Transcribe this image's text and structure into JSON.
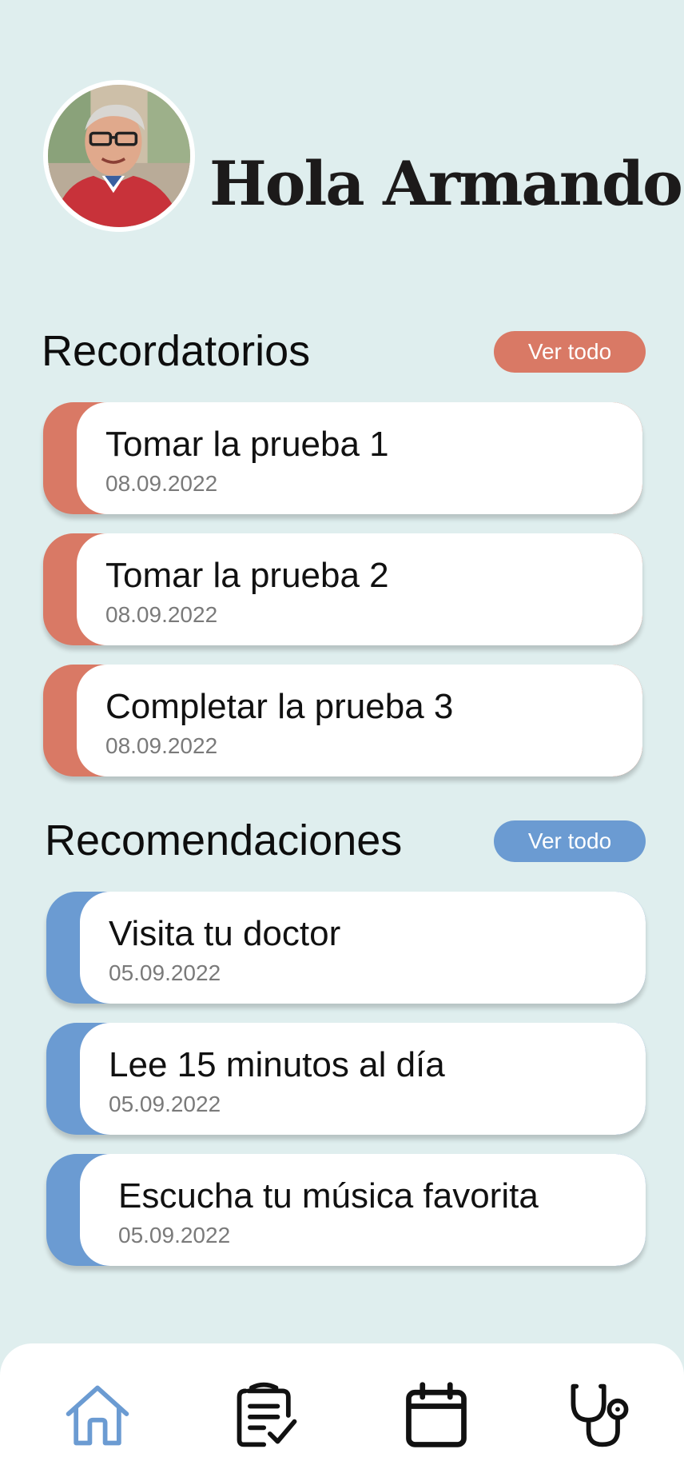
{
  "header": {
    "greeting": "Hola Armando",
    "avatar_icon": "user-photo"
  },
  "reminders": {
    "title": "Recordatorios",
    "see_all_label": "Ver todo",
    "accent": "#d97965",
    "items": [
      {
        "title": "Tomar la prueba 1",
        "date": "08.09.2022"
      },
      {
        "title": "Tomar la prueba 2",
        "date": "08.09.2022"
      },
      {
        "title": "Completar la prueba 3",
        "date": "08.09.2022"
      }
    ]
  },
  "recommendations": {
    "title": "Recomendaciones",
    "see_all_label": "Ver todo",
    "accent": "#6b9bd2",
    "items": [
      {
        "title": "Visita tu doctor",
        "date": "05.09.2022"
      },
      {
        "title": "Lee 15 minutos al día",
        "date": "05.09.2022"
      },
      {
        "title": "Escucha tu música favorita",
        "date": "05.09.2022"
      }
    ]
  },
  "nav": {
    "items": [
      {
        "icon": "home-icon",
        "active": true
      },
      {
        "icon": "checklist-icon",
        "active": false
      },
      {
        "icon": "calendar-icon",
        "active": false
      },
      {
        "icon": "stethoscope-icon",
        "active": false
      }
    ],
    "active_color": "#6b9bd2",
    "inactive_color": "#111111"
  }
}
